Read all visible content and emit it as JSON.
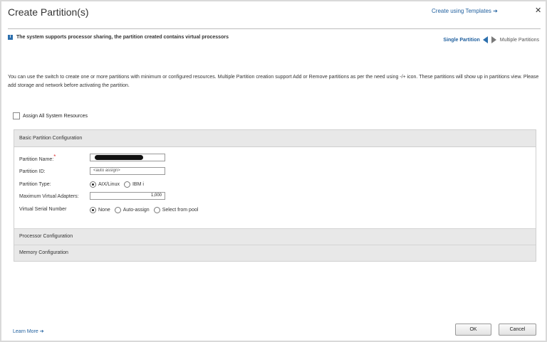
{
  "dialog": {
    "title": "Create Partition(s)",
    "templates_link": "Create using Templates ➔",
    "close": "✕"
  },
  "info": {
    "icon": "i",
    "text": "The system supports processor sharing, the partition created contains virtual processors"
  },
  "mode": {
    "single": "Single Partition",
    "multiple": "Multiple Partitions"
  },
  "description": "You can use the switch to create one or more partitions with minimum or configured resources. Multiple Partition creation support Add or Remove partitions as per the need using -/+ icon. These partitions will show up in partitions view. Please add storage and network before activating the partition.",
  "assign_all": "Assign All System Resources",
  "basic": {
    "header": "Basic Partition Configuration",
    "name_label": "Partition Name:",
    "name_required": "*",
    "id_label": "Partition ID:",
    "id_placeholder": "<auto assign>",
    "type_label": "Partition Type:",
    "type_options": [
      "AIX/Linux",
      "IBM i"
    ],
    "max_va_label": "Maximum Virtual Adapters:",
    "max_va_value": "1,000",
    "serial_label": "Virtual Serial Number",
    "serial_options": [
      "None",
      "Auto-assign",
      "Select from pool"
    ]
  },
  "sections": {
    "processor": "Processor Configuration",
    "memory": "Memory Configuration"
  },
  "footer": {
    "learn_more": "Learn More ➔",
    "ok": "OK",
    "cancel": "Cancel"
  }
}
